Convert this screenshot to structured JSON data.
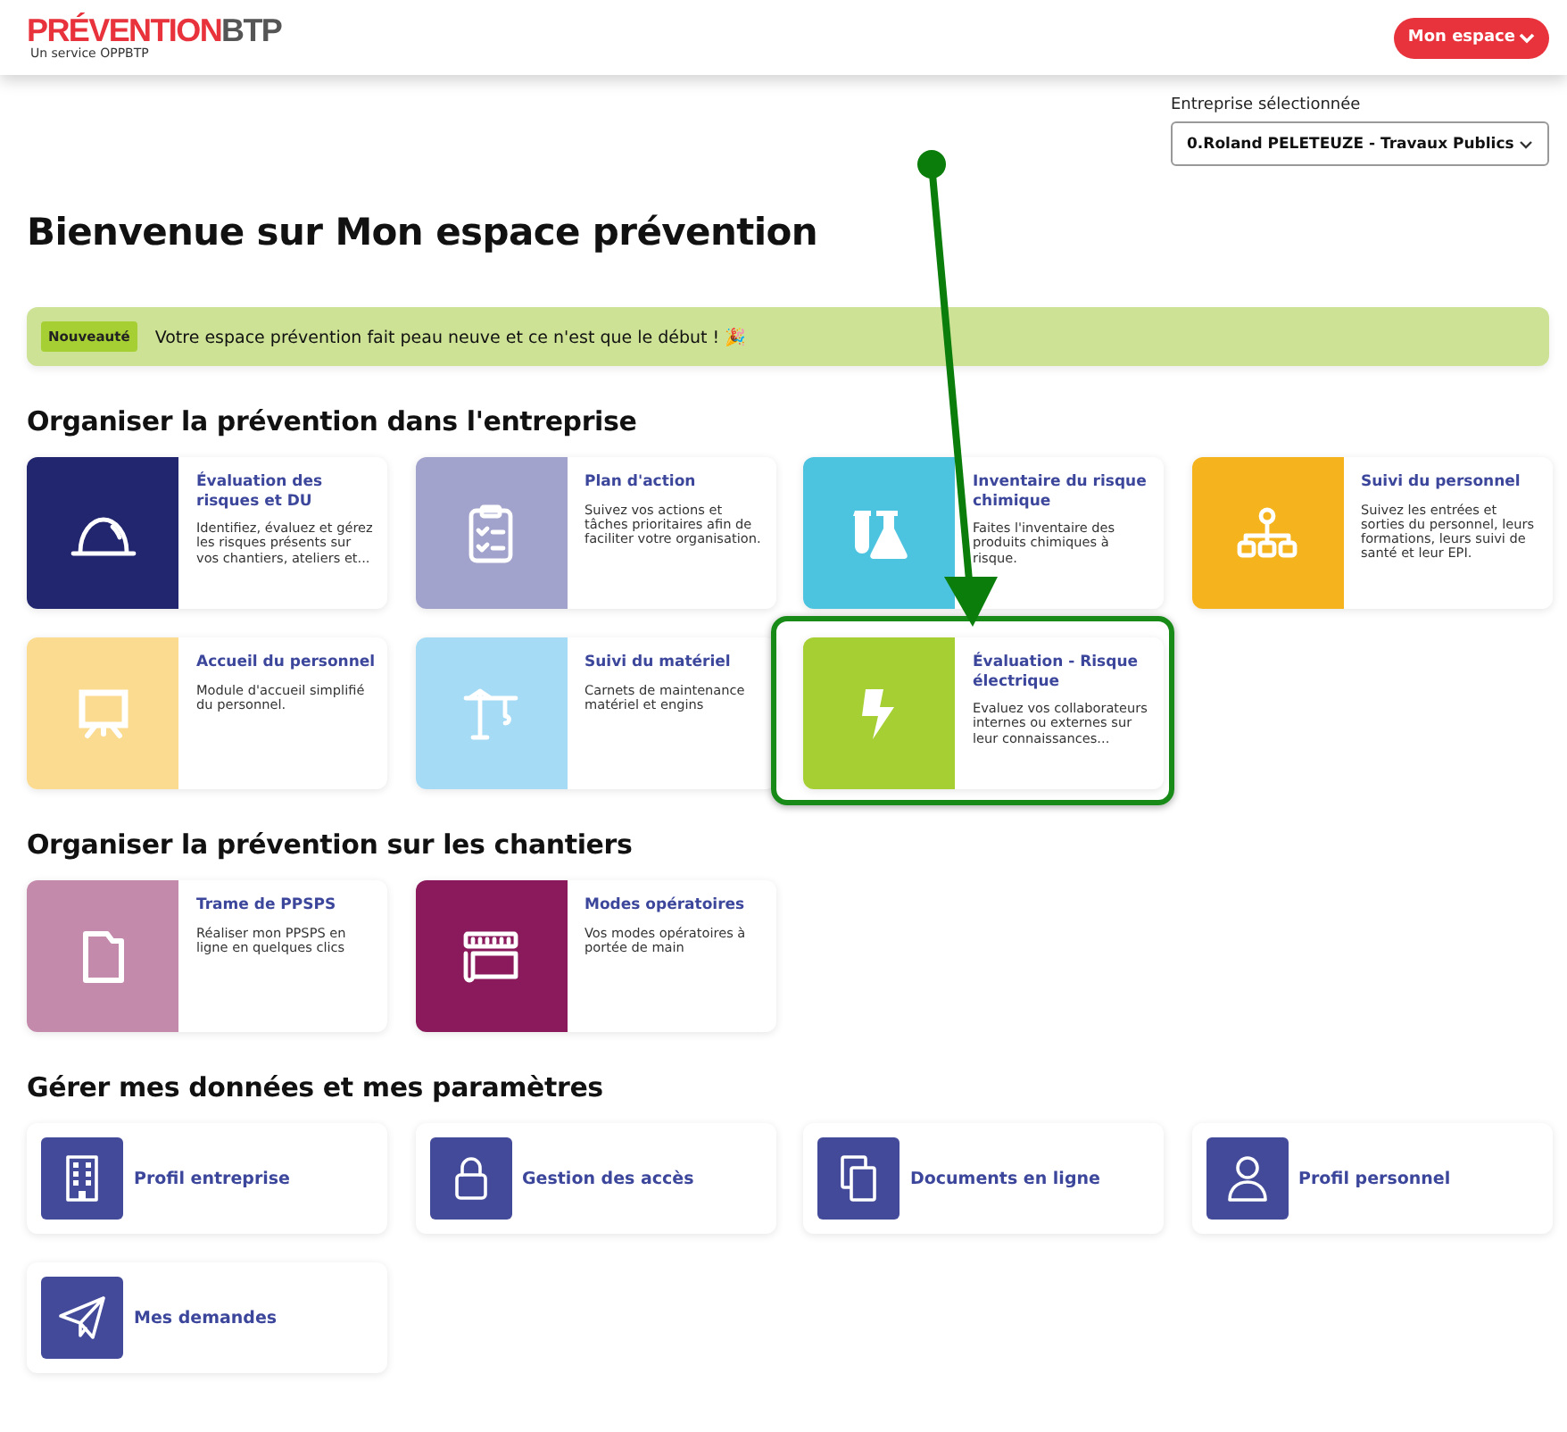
{
  "header": {
    "logo_main": "PRÉVENTION",
    "logo_accent": "BTP",
    "logo_tagline": "Un service OPPBTP",
    "account_button": "Mon espace"
  },
  "company_select": {
    "label": "Entreprise sélectionnée",
    "value": "0.Roland PELETEUZE - Travaux Publics"
  },
  "page_title": "Bienvenue sur Mon espace prévention",
  "banner": {
    "badge": "Nouveauté",
    "message": "Votre espace prévention fait peau neuve et ce n'est que le début ! 🎉"
  },
  "sections": [
    {
      "title": "Organiser la prévention dans l'entreprise",
      "kind": "tile",
      "cards": [
        {
          "title": "Évaluation des risques et DU",
          "description": "Identifiez, évaluez et gérez les risques présents sur vos chantiers, ateliers et...",
          "color": "#22266f",
          "highlighted": false
        },
        {
          "title": "Plan d'action",
          "description": "Suivez vos actions et tâches prioritaires afin de faciliter votre organisation.",
          "color": "#a1a3cc",
          "highlighted": false
        },
        {
          "title": "Inventaire du risque chimique",
          "description": "Faites l'inventaire des produits chimiques à risque.",
          "color": "#4cc3df",
          "highlighted": false
        },
        {
          "title": "Suivi du personnel",
          "description": "Suivez les entrées et sorties du personnel, leurs formations, leurs suivi de santé et leur EPI.",
          "color": "#f5b31e",
          "highlighted": false
        },
        {
          "title": "Accueil du personnel",
          "description": "Module d'accueil simplifié du personnel.",
          "color": "#fbdb8f",
          "highlighted": false
        },
        {
          "title": "Suivi du matériel",
          "description": "Carnets de maintenance matériel et engins",
          "color": "#a6dbf5",
          "highlighted": false
        },
        {
          "title": "Évaluation - Risque électrique",
          "description": "Evaluez vos collaborateurs internes ou externes sur leur connaissances...",
          "color": "#a6cf33",
          "highlighted": true
        }
      ]
    },
    {
      "title": "Organiser la prévention sur les chantiers",
      "kind": "tile",
      "cards": [
        {
          "title": "Trame de PPSPS",
          "description": "Réaliser mon PPSPS en ligne en quelques clics",
          "color": "#c48aac",
          "highlighted": false
        },
        {
          "title": "Modes opératoires",
          "description": "Vos modes opératoires à portée de main",
          "color": "#8b1a5c",
          "highlighted": false
        }
      ]
    },
    {
      "title": "Gérer mes données et mes paramètres",
      "kind": "compact",
      "cards": [
        {
          "title": "Profil entreprise"
        },
        {
          "title": "Gestion des accès"
        },
        {
          "title": "Documents en ligne"
        },
        {
          "title": "Profil personnel"
        },
        {
          "title": "Mes demandes"
        }
      ]
    }
  ]
}
